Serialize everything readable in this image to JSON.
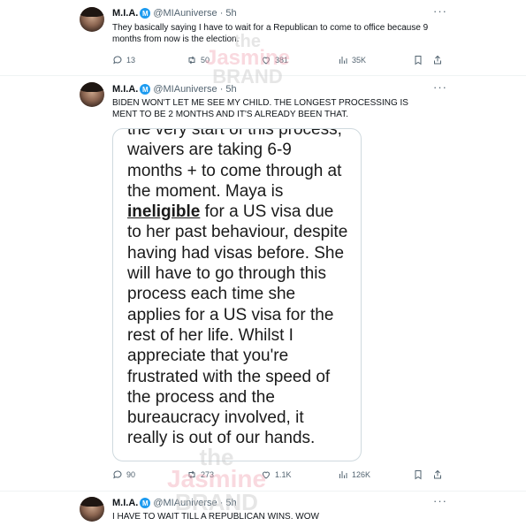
{
  "tweets": [
    {
      "name": "M.I.A.",
      "verified_glyph": "M",
      "handle_time": "@MIAuniverse · 5h",
      "more": "···",
      "text": "They basically saying I have to wait for a Republican to come to office because 9 months from now is the election.",
      "actions": {
        "replies": "13",
        "reposts": "50",
        "likes": "381",
        "views": "35K"
      }
    },
    {
      "name": "M.I.A.",
      "verified_glyph": "M",
      "handle_time": "@MIAuniverse · 5h",
      "more": "···",
      "text": "BIDEN WON'T LET ME SEE MY CHILD.  THE LONGEST PROCESSING IS MENT TO BE 2 MONTHS AND IT'S ALREADY BEEN THAT.",
      "image_text": {
        "line_top": "the very start of this process,",
        "before_bold": "waivers are taking 6-9 months + to come through at the moment. Maya is ",
        "bold": "ineligible",
        "after_bold": " for a US visa due to her past behaviour, despite having had visas before. She will have to go through this process each time she applies for a US visa for the rest of her life. Whilst I appreciate that you're frustrated with the speed of the process and the bureaucracy involved, it really is out of our hands."
      },
      "actions": {
        "replies": "90",
        "reposts": "273",
        "likes": "1.1K",
        "views": "126K"
      }
    },
    {
      "name": "M.I.A.",
      "verified_glyph": "M",
      "handle_time": "@MIAuniverse · 5h",
      "more": "···",
      "text": "I HAVE TO WAIT TILL A REPUBLICAN WINS. WOW"
    }
  ],
  "watermark": {
    "word1": "the",
    "word2": "Jasmine",
    "word3": "BRAND"
  },
  "colors": {
    "verified": "#1d9bf0",
    "muted": "#536471",
    "text": "#0f1419"
  }
}
